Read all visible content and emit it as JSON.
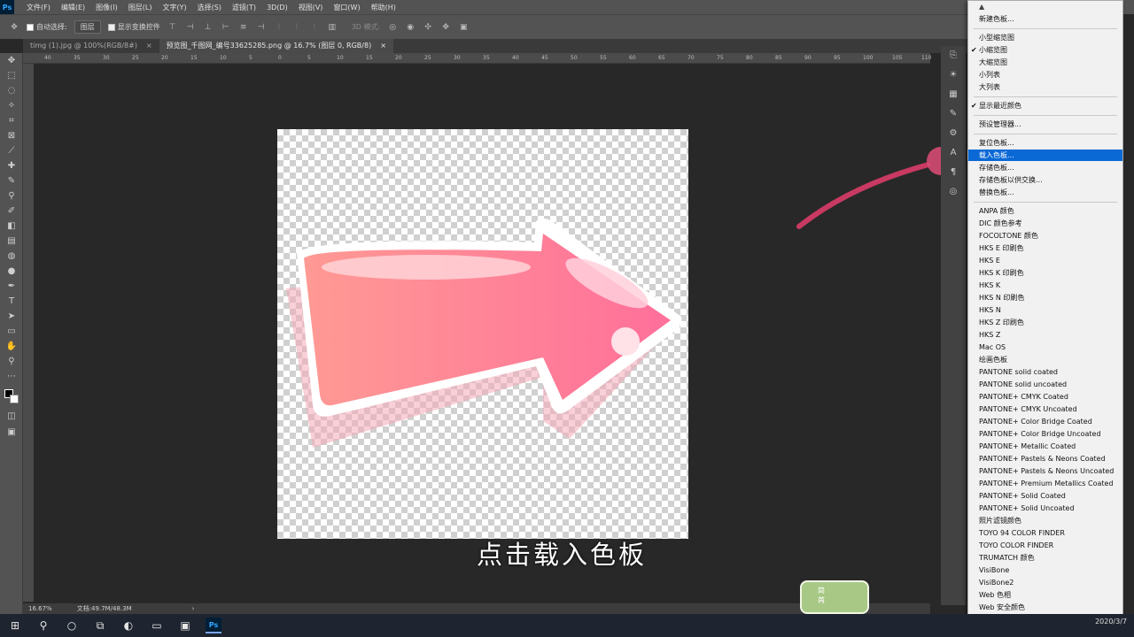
{
  "menubar": {
    "logo": "Ps",
    "items": [
      "文件(F)",
      "编辑(E)",
      "图像(I)",
      "图层(L)",
      "文字(Y)",
      "选择(S)",
      "滤镜(T)",
      "3D(D)",
      "视图(V)",
      "窗口(W)",
      "帮助(H)"
    ]
  },
  "options": {
    "auto_select_label": "自动选择:",
    "auto_select_value": "图层",
    "show_transform_label": "显示变换控件",
    "mode_3d": "3D 模式:"
  },
  "tabs": [
    {
      "label": "timg (1).jpg @ 100%(RGB/8#)",
      "close": "×"
    },
    {
      "label": "预览图_千图网_编号33625285.png @ 16.7% (图层 0, RGB/8)",
      "close": "×"
    }
  ],
  "ruler_ticks": [
    "40",
    "35",
    "30",
    "25",
    "20",
    "15",
    "10",
    "5",
    "0",
    "5",
    "10",
    "15",
    "20",
    "25",
    "30",
    "35",
    "40",
    "45",
    "50",
    "55",
    "60",
    "65",
    "70",
    "75",
    "80",
    "85",
    "90",
    "95",
    "100",
    "105",
    "110"
  ],
  "status": {
    "zoom": "16.67%",
    "doc": "文档:49.7M/48.3M",
    "arrow": "›"
  },
  "subtitle": "点击载入色板",
  "badge": {
    "line1": "简",
    "line2": "苒"
  },
  "taskbar": {
    "date": "2020/3/7"
  },
  "dropdown": {
    "top_arrow": "▲",
    "bottom_arrow": "▼",
    "items": [
      {
        "label": "新建色板...",
        "checked": false
      },
      {
        "label": "小型缩览图",
        "checked": false
      },
      {
        "label": "小缩览图",
        "checked": true
      },
      {
        "label": "大缩览图",
        "checked": false
      },
      {
        "label": "小列表",
        "checked": false
      },
      {
        "label": "大列表",
        "checked": false
      },
      {
        "label": "显示最近颜色",
        "checked": true
      },
      {
        "label": "预设管理器...",
        "checked": false
      },
      {
        "label": "复位色板...",
        "checked": false
      },
      {
        "label": "载入色板...",
        "checked": false,
        "highlighted": true
      },
      {
        "label": "存储色板...",
        "checked": false
      },
      {
        "label": "存储色板以供交换...",
        "checked": false
      },
      {
        "label": "替换色板...",
        "checked": false
      },
      {
        "label": "ANPA 颜色"
      },
      {
        "label": "DIC 颜色参考"
      },
      {
        "label": "FOCOLTONE 颜色"
      },
      {
        "label": "HKS E 印刷色"
      },
      {
        "label": "HKS E"
      },
      {
        "label": "HKS K 印刷色"
      },
      {
        "label": "HKS K"
      },
      {
        "label": "HKS N 印刷色"
      },
      {
        "label": "HKS N"
      },
      {
        "label": "HKS Z 印刷色"
      },
      {
        "label": "HKS Z"
      },
      {
        "label": "Mac OS"
      },
      {
        "label": "绘画色板"
      },
      {
        "label": "PANTONE solid coated"
      },
      {
        "label": "PANTONE solid uncoated"
      },
      {
        "label": "PANTONE+ CMYK Coated"
      },
      {
        "label": "PANTONE+ CMYK Uncoated"
      },
      {
        "label": "PANTONE+ Color Bridge Coated"
      },
      {
        "label": "PANTONE+ Color Bridge Uncoated"
      },
      {
        "label": "PANTONE+ Metallic Coated"
      },
      {
        "label": "PANTONE+ Pastels & Neons Coated"
      },
      {
        "label": "PANTONE+ Pastels & Neons Uncoated"
      },
      {
        "label": "PANTONE+ Premium Metallics Coated"
      },
      {
        "label": "PANTONE+ Solid Coated"
      },
      {
        "label": "PANTONE+ Solid Uncoated"
      },
      {
        "label": "照片滤镜颜色"
      },
      {
        "label": "TOYO 94 COLOR FINDER"
      },
      {
        "label": "TOYO COLOR FINDER"
      },
      {
        "label": "TRUMATCH 颜色"
      },
      {
        "label": "VisiBone"
      },
      {
        "label": "VisiBone2"
      },
      {
        "label": "Web 色相"
      },
      {
        "label": "Web 安全颜色"
      }
    ]
  },
  "colors": {
    "menu_highlight": "#0b69d6",
    "arrow_pink": "#ff7ba0",
    "annotation_stroke": "#c83a62"
  }
}
